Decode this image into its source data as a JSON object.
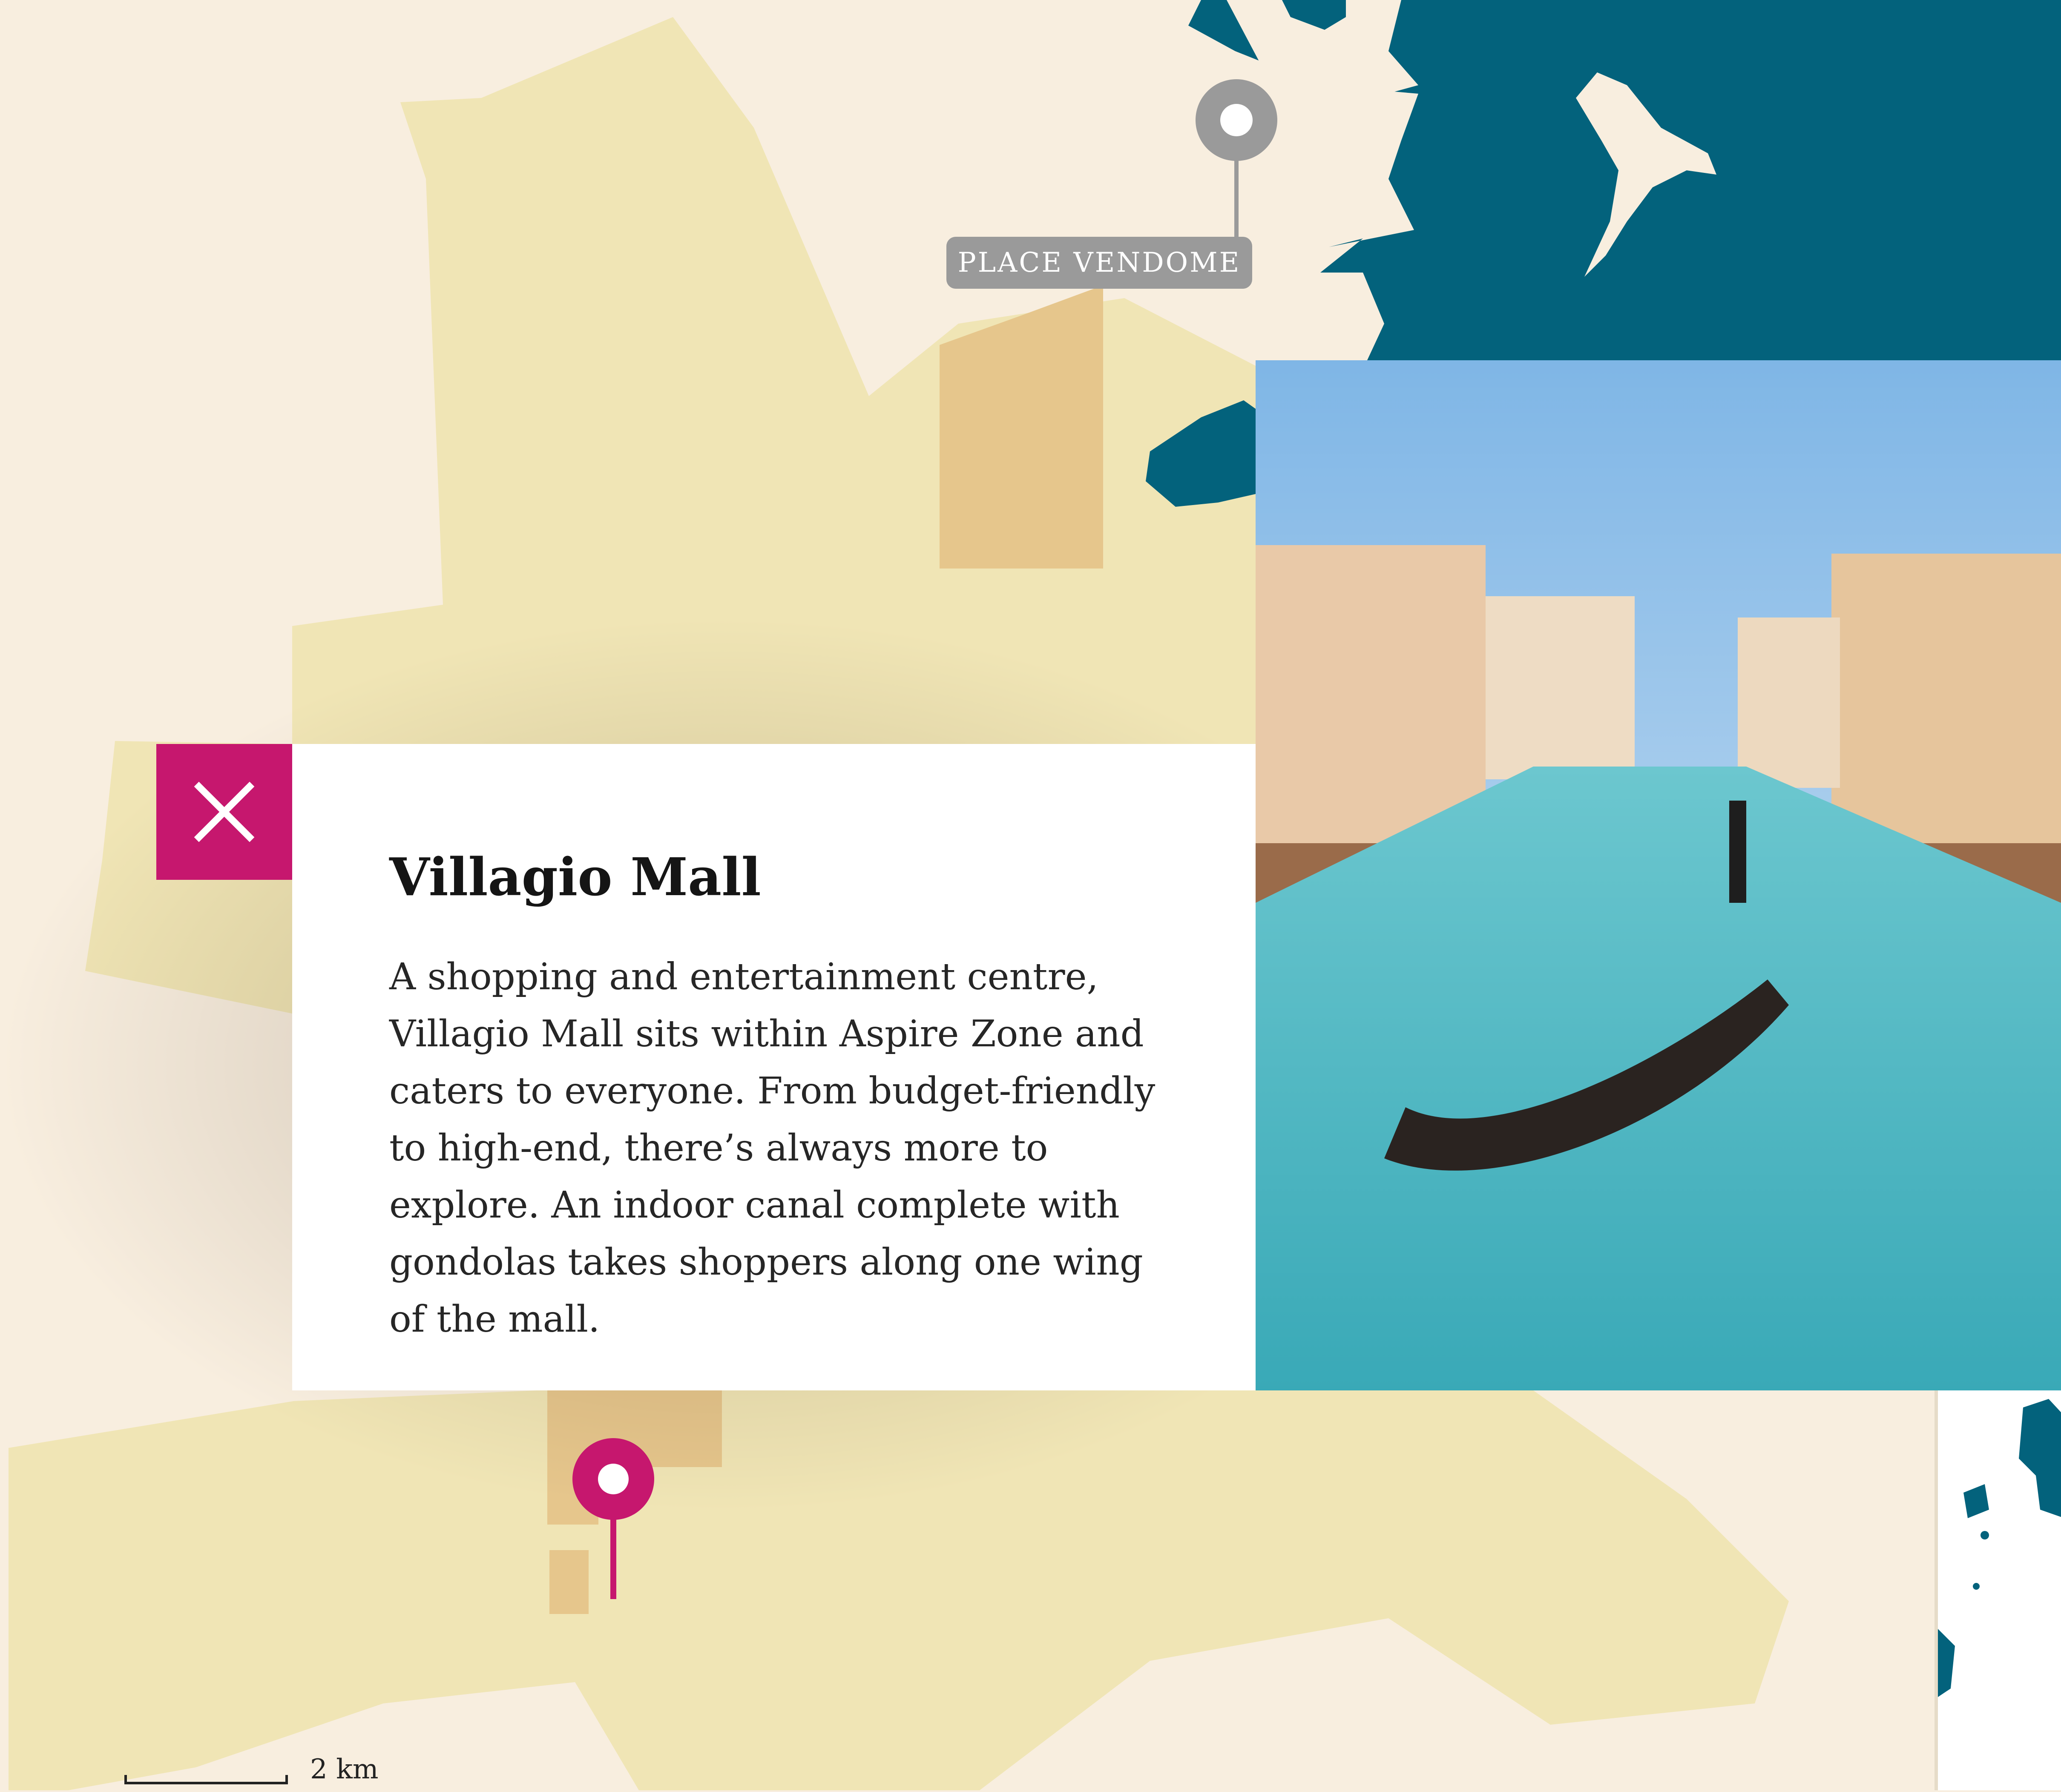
{
  "colors": {
    "land": "#F8EEDF",
    "zone": "#F0E5B5",
    "building": "#E6C68C",
    "water": "#03627C",
    "accent": "#C6176E",
    "pin_gray": "#9a9a9a"
  },
  "map": {
    "pins": [
      {
        "label": "PLACE VENDOME",
        "color": "gray"
      },
      {
        "label": "",
        "color": "magenta",
        "selected": true
      }
    ],
    "scale_label": "2 km"
  },
  "popup": {
    "close_icon": "close-icon",
    "title": "Villagio Mall",
    "body": "A shopping and entertainment centre, Villagio Mall sits within Aspire Zone and caters to everyone. From budget-friendly to high-end, there’s always more to explore. An indoor canal complete with gondolas takes shoppers along one wing of the mall.",
    "image": "gondola-canal-photo"
  }
}
